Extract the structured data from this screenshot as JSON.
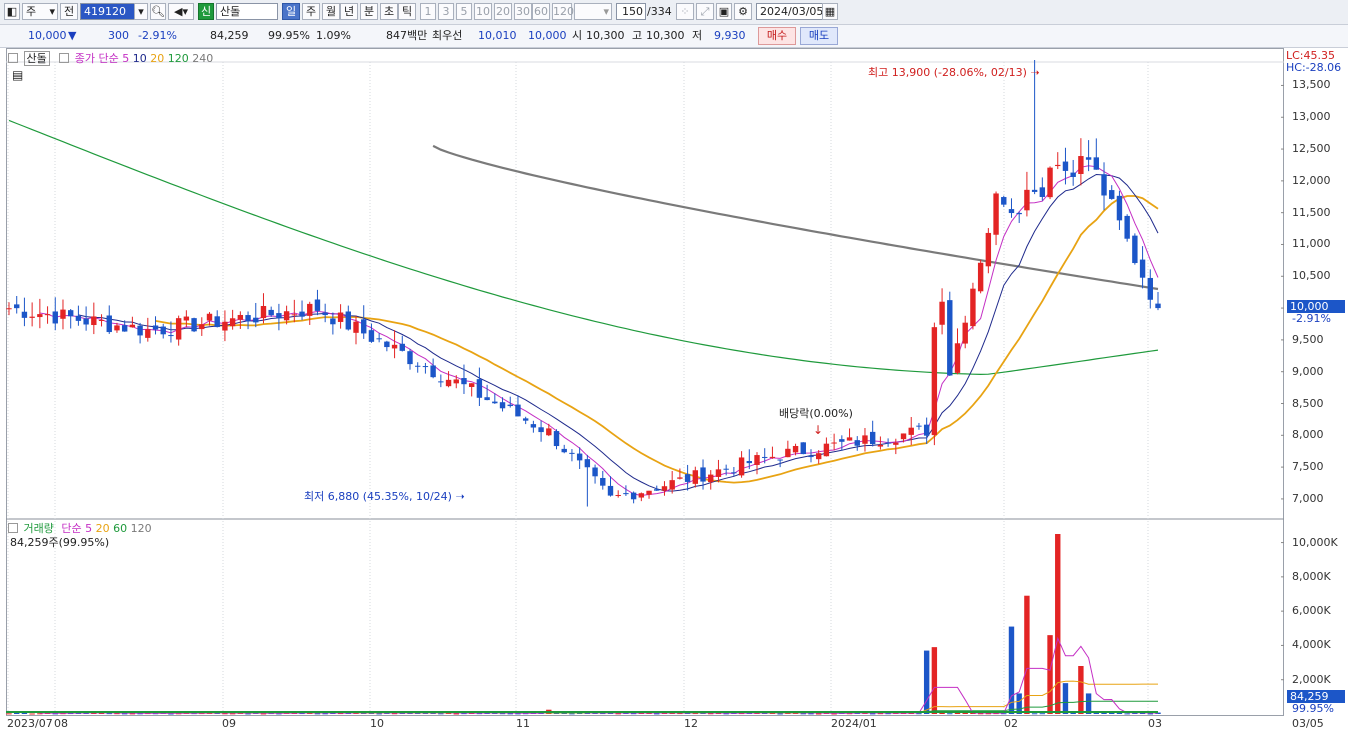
{
  "toolbar": {
    "type_label": "주",
    "market_label": "전",
    "code_value": "419120",
    "credit_badge": "신",
    "stock_name": "산돌",
    "periods": [
      "일",
      "주",
      "월",
      "년",
      "분",
      "초",
      "틱"
    ],
    "selected_period": "일",
    "intervals": [
      "1",
      "3",
      "5",
      "10",
      "20",
      "30",
      "60",
      "120"
    ],
    "count_value": "150",
    "count_total": "/334",
    "date_value": "2024/03/05"
  },
  "quote": {
    "price": "10,000",
    "change_arrow": "▼",
    "change": "300",
    "change_pct": "-2.91%",
    "volume": "84,259",
    "volume_ratio": "99.95%",
    "turnover": "1.09%",
    "amount": "847백만",
    "best_bid_label": "최우선",
    "ask": "10,010",
    "bid": "10,000",
    "open_label": "시",
    "open": "10,300",
    "high_label": "고",
    "high": "10,300",
    "low_label": "저",
    "low": "9,930",
    "buy_label": "매수",
    "sell_label": "매도"
  },
  "price_panel": {
    "name_tag": "산돌",
    "legend_prefix": "종가 단순",
    "ma_labels": [
      "5",
      "10",
      "20",
      "120",
      "240"
    ],
    "lc_label": "LC:45.35",
    "hc_label": "HC:-28.06",
    "high_annotation": "최고 13,900 (-28.06%, 02/13)",
    "low_annotation": "최저 6,880 (45.35%, 10/24)",
    "dividend_annotation": "배당락(0.00%)",
    "y_ticks": [
      "13,500",
      "13,000",
      "12,500",
      "12,000",
      "11,500",
      "11,000",
      "10,500",
      "10,000",
      "9,500",
      "9,000",
      "8,500",
      "8,000",
      "7,500",
      "7,000"
    ],
    "current_price_tag": "10,000",
    "current_pct_tag": "-2.91%"
  },
  "volume_panel": {
    "legend_prefix": "거래량",
    "legend_ma": "단순",
    "ma_labels": [
      "5",
      "20",
      "60",
      "120"
    ],
    "volume_info": "84,259주(99.95%)",
    "y_ticks": [
      "10,000K",
      "8,000K",
      "6,000K",
      "4,000K",
      "2,000K"
    ],
    "current_volume_tag": "84,259",
    "current_pct_tag": "99.95%"
  },
  "x_axis": {
    "labels": [
      "2023/07",
      "08",
      "09",
      "10",
      "11",
      "12",
      "2024/01",
      "02",
      "03",
      "03/05"
    ]
  },
  "colors": {
    "up": "#e32424",
    "down": "#1c56c8",
    "ma5": "#c42fc4",
    "ma10": "#1f2a8c",
    "ma20": "#e8a313",
    "ma120": "#1f9a3c",
    "ma240": "#7a7a7a"
  },
  "chart_data": {
    "type": "candlestick",
    "x": [
      "2023/07",
      "08",
      "09",
      "10",
      "11",
      "12",
      "2024/01",
      "02",
      "03"
    ],
    "close_keypoints": [
      10000,
      9650,
      10000,
      8050,
      7000,
      7700,
      8100,
      11700,
      12350,
      10000
    ],
    "ylim": [
      6700,
      13900
    ],
    "high": 13900,
    "low": 6880,
    "last": 10000,
    "volume_ylim": [
      0,
      10500000
    ]
  }
}
